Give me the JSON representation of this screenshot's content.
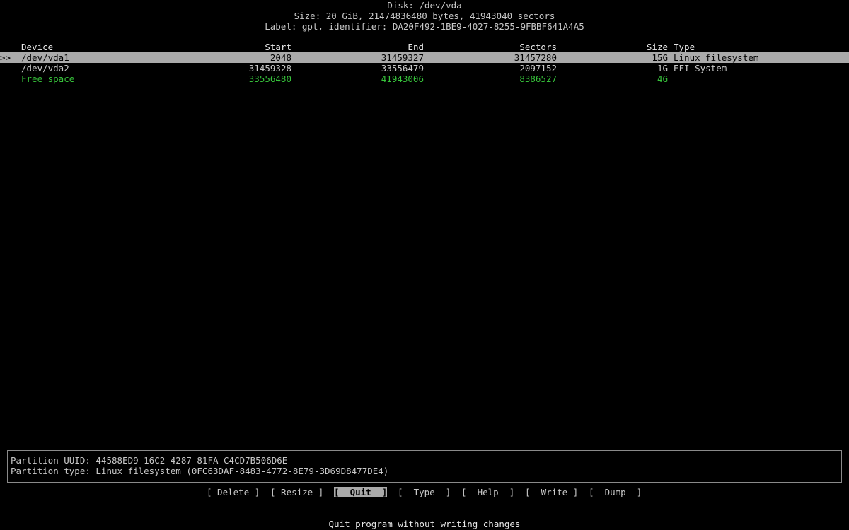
{
  "header": {
    "disk": "Disk: /dev/vda",
    "size": "Size: 20 GiB, 21474836480 bytes, 41943040 sectors",
    "label": "Label: gpt, identifier: DA20F492-1BE9-4027-8255-9FBBF641A4A5"
  },
  "table": {
    "columns": [
      "Device",
      "Start",
      "End",
      "Sectors",
      "Size",
      "Type"
    ],
    "pointer": ">>",
    "rows": [
      {
        "device": "/dev/vda1",
        "start": "2048",
        "end": "31459327",
        "sectors": "31457280",
        "size": "15G",
        "type": "Linux filesystem"
      },
      {
        "device": "/dev/vda2",
        "start": "31459328",
        "end": "33556479",
        "sectors": "2097152",
        "size": "1G",
        "type": "EFI System"
      },
      {
        "device": "Free space",
        "start": "33556480",
        "end": "41943006",
        "sectors": "8386527",
        "size": "4G",
        "type": ""
      }
    ]
  },
  "info": {
    "uuid": "Partition UUID: 44588ED9-16C2-4287-81FA-C4CD7B506D6E",
    "type": "Partition type: Linux filesystem (0FC63DAF-8483-4772-8E79-3D69D8477DE4)"
  },
  "menu": {
    "delete": "[ Delete ]",
    "resize": "[ Resize ]",
    "quit": "[  Quit  ]",
    "type": "[  Type  ]",
    "help": "[  Help  ]",
    "write": "[  Write ]",
    "dump": "[  Dump  ]"
  },
  "hint": "Quit program without writing changes",
  "colors": {
    "background": "#000000",
    "text": "#c8c8c8",
    "selected_bg": "#aaaaaa",
    "free_space": "#36c23a"
  }
}
